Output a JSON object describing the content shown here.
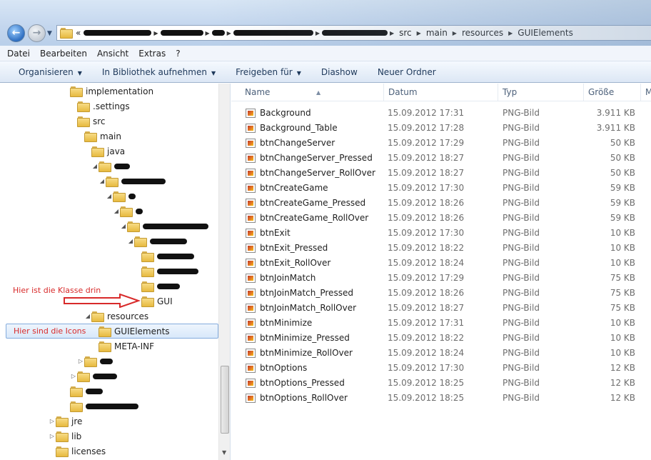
{
  "breadcrumb": {
    "prefix": "«",
    "visible": [
      "src",
      "main",
      "resources",
      "GUIElements"
    ]
  },
  "menu": [
    "Datei",
    "Bearbeiten",
    "Ansicht",
    "Extras",
    "?"
  ],
  "toolbar": {
    "organize": "Organisieren",
    "library": "In Bibliothek aufnehmen",
    "share": "Freigeben für",
    "slideshow": "Diashow",
    "new_folder": "Neuer Ordner"
  },
  "tree": {
    "implementation": "implementation",
    "settings": ".settings",
    "src": "src",
    "main": "main",
    "java": "java",
    "gui": "GUI",
    "resources": "resources",
    "guielements": "GUIElements",
    "metainf": "META-INF",
    "jre": "jre",
    "lib": "lib",
    "licenses": "licenses"
  },
  "annotations": {
    "class_note": "Hier ist die Klasse drin",
    "icons_note": "Hier sind die Icons"
  },
  "columns": {
    "name": "Name",
    "date": "Datum",
    "type": "Typ",
    "size": "Größe",
    "more": "M"
  },
  "files": [
    {
      "name": "Background",
      "date": "15.09.2012 17:31",
      "type": "PNG-Bild",
      "size": "3.911 KB"
    },
    {
      "name": "Background_Table",
      "date": "15.09.2012 17:28",
      "type": "PNG-Bild",
      "size": "3.911 KB"
    },
    {
      "name": "btnChangeServer",
      "date": "15.09.2012 17:29",
      "type": "PNG-Bild",
      "size": "50 KB"
    },
    {
      "name": "btnChangeServer_Pressed",
      "date": "15.09.2012 18:27",
      "type": "PNG-Bild",
      "size": "50 KB"
    },
    {
      "name": "btnChangeServer_RollOver",
      "date": "15.09.2012 18:27",
      "type": "PNG-Bild",
      "size": "50 KB"
    },
    {
      "name": "btnCreateGame",
      "date": "15.09.2012 17:30",
      "type": "PNG-Bild",
      "size": "59 KB"
    },
    {
      "name": "btnCreateGame_Pressed",
      "date": "15.09.2012 18:26",
      "type": "PNG-Bild",
      "size": "59 KB"
    },
    {
      "name": "btnCreateGame_RollOver",
      "date": "15.09.2012 18:26",
      "type": "PNG-Bild",
      "size": "59 KB"
    },
    {
      "name": "btnExit",
      "date": "15.09.2012 17:30",
      "type": "PNG-Bild",
      "size": "10 KB"
    },
    {
      "name": "btnExit_Pressed",
      "date": "15.09.2012 18:22",
      "type": "PNG-Bild",
      "size": "10 KB"
    },
    {
      "name": "btnExit_RollOver",
      "date": "15.09.2012 18:24",
      "type": "PNG-Bild",
      "size": "10 KB"
    },
    {
      "name": "btnJoinMatch",
      "date": "15.09.2012 17:29",
      "type": "PNG-Bild",
      "size": "75 KB"
    },
    {
      "name": "btnJoinMatch_Pressed",
      "date": "15.09.2012 18:26",
      "type": "PNG-Bild",
      "size": "75 KB"
    },
    {
      "name": "btnJoinMatch_RollOver",
      "date": "15.09.2012 18:27",
      "type": "PNG-Bild",
      "size": "75 KB"
    },
    {
      "name": "btnMinimize",
      "date": "15.09.2012 17:31",
      "type": "PNG-Bild",
      "size": "10 KB"
    },
    {
      "name": "btnMinimize_Pressed",
      "date": "15.09.2012 18:22",
      "type": "PNG-Bild",
      "size": "10 KB"
    },
    {
      "name": "btnMinimize_RollOver",
      "date": "15.09.2012 18:24",
      "type": "PNG-Bild",
      "size": "10 KB"
    },
    {
      "name": "btnOptions",
      "date": "15.09.2012 17:30",
      "type": "PNG-Bild",
      "size": "12 KB"
    },
    {
      "name": "btnOptions_Pressed",
      "date": "15.09.2012 18:25",
      "type": "PNG-Bild",
      "size": "12 KB"
    },
    {
      "name": "btnOptions_RollOver",
      "date": "15.09.2012 18:25",
      "type": "PNG-Bild",
      "size": "12 KB"
    }
  ],
  "colors": {
    "annotation": "#d82a2a",
    "selection_border": "#84acdd",
    "header_text": "#4c607a"
  }
}
